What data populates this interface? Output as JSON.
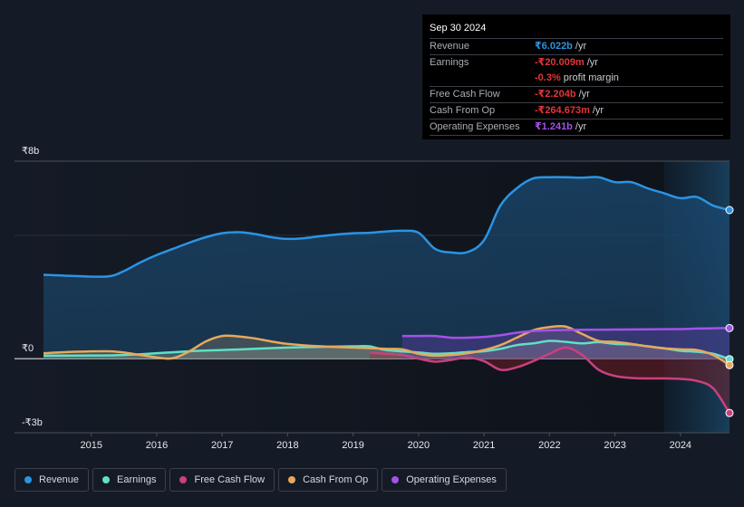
{
  "tooltip": {
    "date": "Sep 30 2024",
    "rows": [
      {
        "label": "Revenue",
        "value": "₹6.022b",
        "suffix": "/yr",
        "color": "#2b94e4"
      },
      {
        "label": "Earnings",
        "value": "-₹20.009m",
        "suffix": "/yr",
        "color": "#e3353a"
      },
      {
        "label": "",
        "value": "-0.3%",
        "suffix": "profit margin",
        "color": "#e3353a"
      },
      {
        "label": "Free Cash Flow",
        "value": "-₹2.204b",
        "suffix": "/yr",
        "color": "#e3353a"
      },
      {
        "label": "Cash From Op",
        "value": "-₹264.673m",
        "suffix": "/yr",
        "color": "#e3353a"
      },
      {
        "label": "Operating Expenses",
        "value": "₹1.241b",
        "suffix": "/yr",
        "color": "#a452e8"
      }
    ]
  },
  "legend": [
    {
      "label": "Revenue",
      "color": "#2b94e4"
    },
    {
      "label": "Earnings",
      "color": "#5fe0c8"
    },
    {
      "label": "Free Cash Flow",
      "color": "#c9417f"
    },
    {
      "label": "Cash From Op",
      "color": "#e8a85c"
    },
    {
      "label": "Operating Expenses",
      "color": "#a452e8"
    }
  ],
  "chart_data": {
    "type": "area",
    "title": "",
    "xlabel": "",
    "ylabel": "",
    "xlim": [
      2014.27,
      2024.75
    ],
    "ylim": [
      -3,
      8
    ],
    "y_tick_labels": [
      {
        "value": 8,
        "label": "₹8b"
      },
      {
        "value": 0,
        "label": "₹0"
      },
      {
        "value": -3,
        "label": "-₹3b"
      }
    ],
    "x_tick_labels": [
      "2015",
      "2016",
      "2017",
      "2018",
      "2019",
      "2020",
      "2021",
      "2022",
      "2023",
      "2024"
    ],
    "x_ticks": [
      2015,
      2016,
      2017,
      2018,
      2019,
      2020,
      2021,
      2022,
      2023,
      2024
    ],
    "gridlines": [
      8,
      5,
      0,
      -3
    ],
    "forecast_shade_start": 2023.75,
    "legend_position": "bottom-left",
    "units": "INR billions",
    "series": [
      {
        "name": "Revenue",
        "color": "#2b94e4",
        "x": [
          2014.27,
          2014.75,
          2015.25,
          2015.5,
          2015.75,
          2016.0,
          2016.25,
          2016.5,
          2016.75,
          2017.0,
          2017.25,
          2017.5,
          2017.75,
          2018.0,
          2018.25,
          2018.5,
          2018.75,
          2019.0,
          2019.25,
          2019.5,
          2019.75,
          2020.0,
          2020.25,
          2020.5,
          2020.75,
          2021.0,
          2021.25,
          2021.5,
          2021.75,
          2022.0,
          2022.25,
          2022.5,
          2022.75,
          2023.0,
          2023.25,
          2023.5,
          2023.75,
          2024.0,
          2024.25,
          2024.5,
          2024.75
        ],
        "values": [
          3.4,
          3.35,
          3.33,
          3.55,
          3.9,
          4.2,
          4.45,
          4.7,
          4.92,
          5.08,
          5.12,
          5.05,
          4.92,
          4.85,
          4.88,
          4.96,
          5.03,
          5.08,
          5.1,
          5.15,
          5.18,
          5.1,
          4.45,
          4.3,
          4.32,
          4.8,
          6.2,
          6.9,
          7.3,
          7.35,
          7.35,
          7.33,
          7.35,
          7.15,
          7.15,
          6.9,
          6.7,
          6.5,
          6.55,
          6.2,
          6.02
        ]
      },
      {
        "name": "Earnings",
        "color": "#5fe0c8",
        "x": [
          2014.27,
          2015.0,
          2015.5,
          2016.0,
          2016.5,
          2017.0,
          2017.5,
          2018.0,
          2018.5,
          2019.0,
          2019.25,
          2019.5,
          2020.0,
          2020.25,
          2020.5,
          2020.75,
          2021.0,
          2021.25,
          2021.5,
          2021.75,
          2022.0,
          2022.25,
          2022.5,
          2022.75,
          2023.0,
          2023.25,
          2023.5,
          2023.75,
          2024.0,
          2024.25,
          2024.5,
          2024.75
        ],
        "values": [
          0.12,
          0.13,
          0.15,
          0.22,
          0.3,
          0.35,
          0.4,
          0.45,
          0.48,
          0.5,
          0.5,
          0.35,
          0.25,
          0.2,
          0.22,
          0.27,
          0.3,
          0.4,
          0.55,
          0.62,
          0.72,
          0.68,
          0.62,
          0.67,
          0.6,
          0.58,
          0.5,
          0.42,
          0.32,
          0.28,
          0.2,
          -0.02
        ]
      },
      {
        "name": "Free Cash Flow",
        "color": "#c9417f",
        "x": [
          2019.25,
          2019.5,
          2019.75,
          2020.0,
          2020.25,
          2020.5,
          2020.75,
          2021.0,
          2021.25,
          2021.5,
          2021.75,
          2022.0,
          2022.25,
          2022.5,
          2022.75,
          2023.0,
          2023.25,
          2023.5,
          2023.75,
          2024.0,
          2024.25,
          2024.5,
          2024.75
        ],
        "values": [
          0.25,
          0.2,
          0.15,
          0.0,
          -0.12,
          -0.05,
          0.05,
          -0.1,
          -0.45,
          -0.35,
          -0.1,
          0.2,
          0.45,
          0.15,
          -0.45,
          -0.7,
          -0.78,
          -0.8,
          -0.8,
          -0.82,
          -0.9,
          -1.2,
          -2.2
        ]
      },
      {
        "name": "Cash From Op",
        "color": "#e8a85c",
        "x": [
          2014.27,
          2014.75,
          2015.25,
          2015.5,
          2016.0,
          2016.25,
          2016.5,
          2016.75,
          2017.0,
          2017.25,
          2017.5,
          2017.75,
          2018.0,
          2018.5,
          2019.0,
          2019.5,
          2019.75,
          2020.0,
          2020.25,
          2020.5,
          2020.75,
          2021.0,
          2021.25,
          2021.5,
          2021.75,
          2022.0,
          2022.25,
          2022.5,
          2022.75,
          2023.0,
          2023.25,
          2023.5,
          2023.75,
          2024.0,
          2024.25,
          2024.5,
          2024.75
        ],
        "values": [
          0.22,
          0.28,
          0.3,
          0.25,
          0.05,
          0.02,
          0.3,
          0.7,
          0.92,
          0.9,
          0.82,
          0.7,
          0.6,
          0.5,
          0.45,
          0.4,
          0.38,
          0.2,
          0.12,
          0.15,
          0.22,
          0.35,
          0.55,
          0.85,
          1.15,
          1.28,
          1.3,
          1.0,
          0.72,
          0.68,
          0.6,
          0.5,
          0.42,
          0.38,
          0.35,
          0.15,
          -0.26
        ]
      },
      {
        "name": "Operating Expenses",
        "color": "#a452e8",
        "x": [
          2019.75,
          2020.0,
          2020.25,
          2020.5,
          2020.75,
          2021.0,
          2021.25,
          2021.5,
          2021.75,
          2022.0,
          2022.5,
          2023.0,
          2023.5,
          2024.0,
          2024.25,
          2024.5,
          2024.75
        ],
        "values": [
          0.92,
          0.92,
          0.92,
          0.85,
          0.85,
          0.88,
          0.95,
          1.05,
          1.12,
          1.15,
          1.17,
          1.18,
          1.19,
          1.2,
          1.22,
          1.23,
          1.24
        ]
      }
    ]
  }
}
